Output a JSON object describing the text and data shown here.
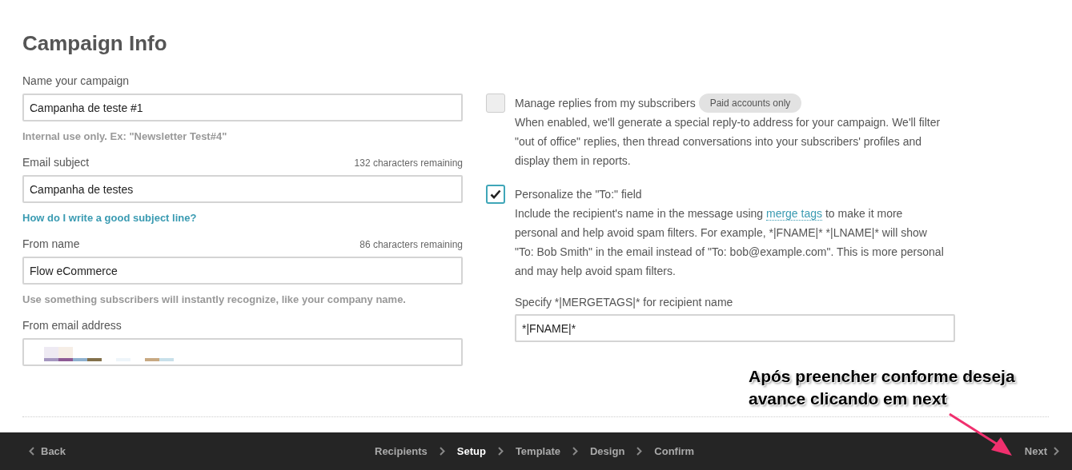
{
  "heading": "Campaign Info",
  "fields": [
    {
      "kind": "text",
      "label": "Name your campaign",
      "value": "Campanha de teste #1",
      "hint": "Internal use only. Ex: \"Newsletter Test#4\""
    },
    {
      "kind": "text",
      "label": "Email subject",
      "counter": "132 characters remaining",
      "value": "Campanha de testes",
      "link": "How do I write a good subject line?"
    },
    {
      "kind": "text",
      "label": "From name",
      "counter": "86 characters remaining",
      "value": "Flow eCommerce",
      "hint": "Use something subscribers will instantly recognize, like your company name."
    },
    {
      "kind": "redacted",
      "label": "From email address"
    }
  ],
  "options": [
    {
      "label": "Manage replies from my subscribers",
      "badge": "Paid accounts only",
      "checked": false,
      "description": [
        {
          "text": "When enabled, we'll generate a special reply-to address for your campaign. We'll filter \"out of office\" replies, then thread conversations into your subscribers' profiles and display them in reports."
        }
      ]
    },
    {
      "label": "Personalize the \"To:\" field",
      "checked": true,
      "description": [
        {
          "text": "Include the recipient's name in the message using "
        },
        {
          "link": "merge tags"
        },
        {
          "text": " to make it more personal and help avoid spam filters. For example, *|FNAME|* *|LNAME|* will show \"To: Bob Smith\" in the email instead of \"To: bob@example.com\". This is more personal and may help avoid spam filters."
        }
      ]
    }
  ],
  "sub_field": {
    "label": "Specify *|MERGETAGS|* for recipient name",
    "value": "*|FNAME|*"
  },
  "annotation": {
    "lines": [
      "Após preencher conforme deseja",
      "avance clicando em next"
    ]
  },
  "footer": {
    "back": "Back",
    "next": "Next",
    "steps": [
      {
        "label": "Recipients",
        "selected": false
      },
      {
        "label": "Setup",
        "selected": true
      },
      {
        "label": "Template",
        "selected": false
      },
      {
        "label": "Design",
        "selected": false
      },
      {
        "label": "Confirm",
        "selected": false
      }
    ]
  }
}
